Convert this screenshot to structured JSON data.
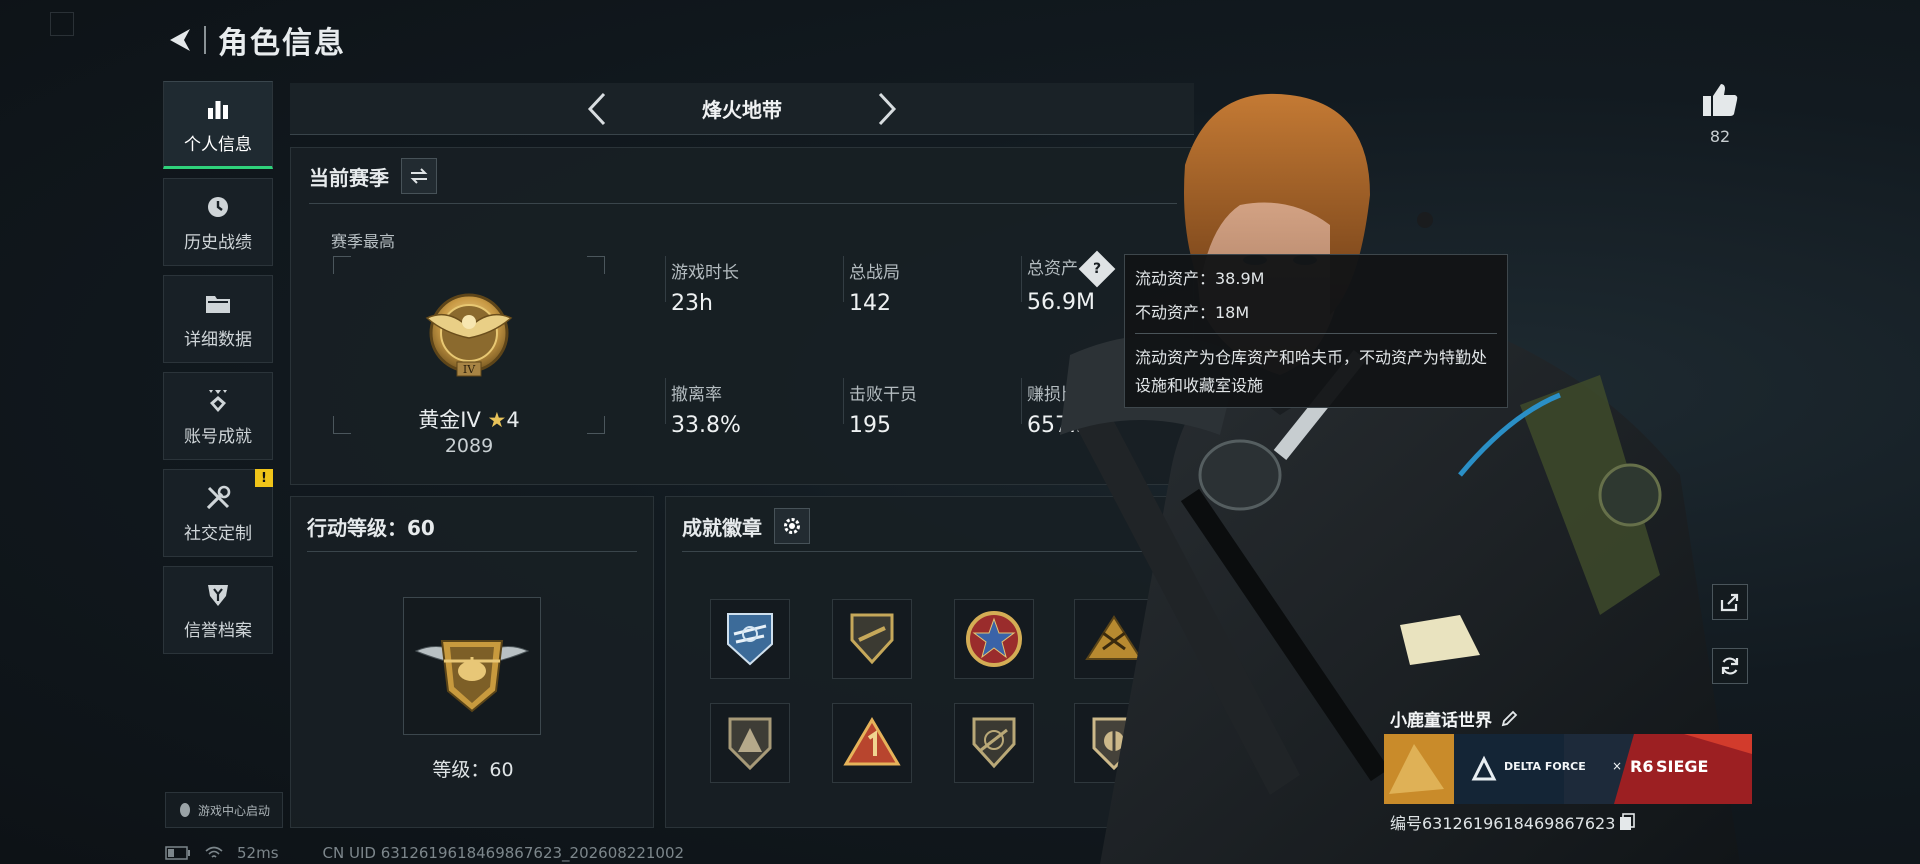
{
  "header": {
    "title": "角色信息"
  },
  "sidebar": {
    "items": [
      {
        "label": "个人信息",
        "icon": "bar-chart-icon",
        "active": true
      },
      {
        "label": "历史战绩",
        "icon": "clock-icon"
      },
      {
        "label": "详细数据",
        "icon": "folder-icon"
      },
      {
        "label": "账号成就",
        "icon": "achievement-icon"
      },
      {
        "label": "社交定制",
        "icon": "tools-icon",
        "badge": "!"
      },
      {
        "label": "信誉档案",
        "icon": "shield-icon"
      }
    ],
    "game_center": "游戏中心启动"
  },
  "mode": {
    "label": "烽火地带"
  },
  "season": {
    "title": "当前赛季",
    "best_label": "赛季最高",
    "rank_name": "黄金IV",
    "rank_stars": "4",
    "rank_tier_mark": "IV",
    "rank_score": "2089",
    "stats": [
      {
        "label": "游戏时长",
        "value": "23h"
      },
      {
        "label": "总战局",
        "value": "142"
      },
      {
        "label": "总资产",
        "value": "56.9M"
      },
      {
        "label": "撤离率",
        "value": "33.8%"
      },
      {
        "label": "击败干员",
        "value": "195"
      },
      {
        "label": "赚损比",
        "value": "657.3K"
      }
    ]
  },
  "tooltip": {
    "liquid": "流动资产：38.9M",
    "fixed": "不动资产：18M",
    "description": "流动资产为仓库资产和哈夫币，不动资产为特勤处设施和收藏室设施"
  },
  "level": {
    "title": "行动等级：60",
    "level_text": "等级：60"
  },
  "badges": {
    "title": "成就徽章",
    "count": 8
  },
  "likes": {
    "count": "82"
  },
  "player": {
    "name": "小鹿童话世界",
    "id_text": "编号6312619618469867623",
    "banner_brand": "DELTA FORCE",
    "banner_x": "×",
    "banner_r6": "R6",
    "banner_siege": "SIEGE"
  },
  "status": {
    "ping": "52ms",
    "uid": "CN UID 6312619618469867623_202608221002"
  },
  "colors": {
    "accent": "#2fd27b",
    "gold": "#c9a04a",
    "alert": "#f0c419"
  }
}
